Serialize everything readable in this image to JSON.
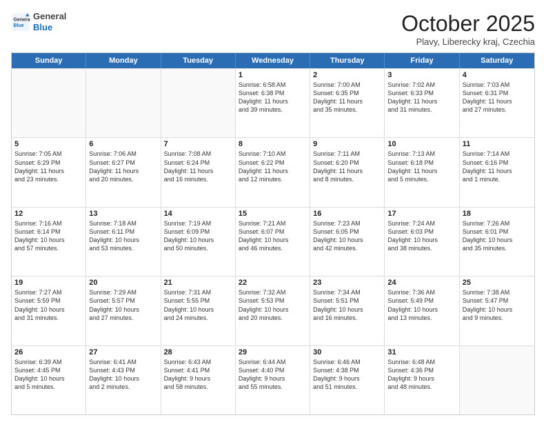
{
  "header": {
    "logo": {
      "general": "General",
      "blue": "Blue"
    },
    "title": "October 2025",
    "subtitle": "Plavy, Liberecky kraj, Czechia"
  },
  "calendar": {
    "days_of_week": [
      "Sunday",
      "Monday",
      "Tuesday",
      "Wednesday",
      "Thursday",
      "Friday",
      "Saturday"
    ],
    "weeks": [
      [
        {
          "day": "",
          "info": ""
        },
        {
          "day": "",
          "info": ""
        },
        {
          "day": "",
          "info": ""
        },
        {
          "day": "1",
          "info": "Sunrise: 6:58 AM\nSunset: 6:38 PM\nDaylight: 11 hours\nand 39 minutes."
        },
        {
          "day": "2",
          "info": "Sunrise: 7:00 AM\nSunset: 6:35 PM\nDaylight: 11 hours\nand 35 minutes."
        },
        {
          "day": "3",
          "info": "Sunrise: 7:02 AM\nSunset: 6:33 PM\nDaylight: 11 hours\nand 31 minutes."
        },
        {
          "day": "4",
          "info": "Sunrise: 7:03 AM\nSunset: 6:31 PM\nDaylight: 11 hours\nand 27 minutes."
        }
      ],
      [
        {
          "day": "5",
          "info": "Sunrise: 7:05 AM\nSunset: 6:29 PM\nDaylight: 11 hours\nand 23 minutes."
        },
        {
          "day": "6",
          "info": "Sunrise: 7:06 AM\nSunset: 6:27 PM\nDaylight: 11 hours\nand 20 minutes."
        },
        {
          "day": "7",
          "info": "Sunrise: 7:08 AM\nSunset: 6:24 PM\nDaylight: 11 hours\nand 16 minutes."
        },
        {
          "day": "8",
          "info": "Sunrise: 7:10 AM\nSunset: 6:22 PM\nDaylight: 11 hours\nand 12 minutes."
        },
        {
          "day": "9",
          "info": "Sunrise: 7:11 AM\nSunset: 6:20 PM\nDaylight: 11 hours\nand 8 minutes."
        },
        {
          "day": "10",
          "info": "Sunrise: 7:13 AM\nSunset: 6:18 PM\nDaylight: 11 hours\nand 5 minutes."
        },
        {
          "day": "11",
          "info": "Sunrise: 7:14 AM\nSunset: 6:16 PM\nDaylight: 11 hours\nand 1 minute."
        }
      ],
      [
        {
          "day": "12",
          "info": "Sunrise: 7:16 AM\nSunset: 6:14 PM\nDaylight: 10 hours\nand 57 minutes."
        },
        {
          "day": "13",
          "info": "Sunrise: 7:18 AM\nSunset: 6:11 PM\nDaylight: 10 hours\nand 53 minutes."
        },
        {
          "day": "14",
          "info": "Sunrise: 7:19 AM\nSunset: 6:09 PM\nDaylight: 10 hours\nand 50 minutes."
        },
        {
          "day": "15",
          "info": "Sunrise: 7:21 AM\nSunset: 6:07 PM\nDaylight: 10 hours\nand 46 minutes."
        },
        {
          "day": "16",
          "info": "Sunrise: 7:23 AM\nSunset: 6:05 PM\nDaylight: 10 hours\nand 42 minutes."
        },
        {
          "day": "17",
          "info": "Sunrise: 7:24 AM\nSunset: 6:03 PM\nDaylight: 10 hours\nand 38 minutes."
        },
        {
          "day": "18",
          "info": "Sunrise: 7:26 AM\nSunset: 6:01 PM\nDaylight: 10 hours\nand 35 minutes."
        }
      ],
      [
        {
          "day": "19",
          "info": "Sunrise: 7:27 AM\nSunset: 5:59 PM\nDaylight: 10 hours\nand 31 minutes."
        },
        {
          "day": "20",
          "info": "Sunrise: 7:29 AM\nSunset: 5:57 PM\nDaylight: 10 hours\nand 27 minutes."
        },
        {
          "day": "21",
          "info": "Sunrise: 7:31 AM\nSunset: 5:55 PM\nDaylight: 10 hours\nand 24 minutes."
        },
        {
          "day": "22",
          "info": "Sunrise: 7:32 AM\nSunset: 5:53 PM\nDaylight: 10 hours\nand 20 minutes."
        },
        {
          "day": "23",
          "info": "Sunrise: 7:34 AM\nSunset: 5:51 PM\nDaylight: 10 hours\nand 16 minutes."
        },
        {
          "day": "24",
          "info": "Sunrise: 7:36 AM\nSunset: 5:49 PM\nDaylight: 10 hours\nand 13 minutes."
        },
        {
          "day": "25",
          "info": "Sunrise: 7:38 AM\nSunset: 5:47 PM\nDaylight: 10 hours\nand 9 minutes."
        }
      ],
      [
        {
          "day": "26",
          "info": "Sunrise: 6:39 AM\nSunset: 4:45 PM\nDaylight: 10 hours\nand 5 minutes."
        },
        {
          "day": "27",
          "info": "Sunrise: 6:41 AM\nSunset: 4:43 PM\nDaylight: 10 hours\nand 2 minutes."
        },
        {
          "day": "28",
          "info": "Sunrise: 6:43 AM\nSunset: 4:41 PM\nDaylight: 9 hours\nand 58 minutes."
        },
        {
          "day": "29",
          "info": "Sunrise: 6:44 AM\nSunset: 4:40 PM\nDaylight: 9 hours\nand 55 minutes."
        },
        {
          "day": "30",
          "info": "Sunrise: 6:46 AM\nSunset: 4:38 PM\nDaylight: 9 hours\nand 51 minutes."
        },
        {
          "day": "31",
          "info": "Sunrise: 6:48 AM\nSunset: 4:36 PM\nDaylight: 9 hours\nand 48 minutes."
        },
        {
          "day": "",
          "info": ""
        }
      ]
    ]
  }
}
